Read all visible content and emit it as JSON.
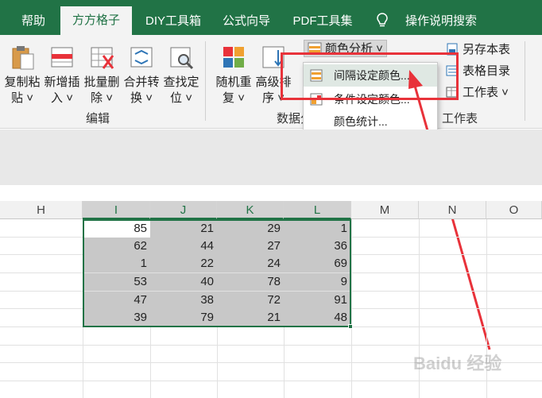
{
  "tabs": [
    {
      "label": "帮助",
      "active": false
    },
    {
      "label": "方方格子",
      "active": true
    },
    {
      "label": "DIY工具箱",
      "active": false
    },
    {
      "label": "公式向导",
      "active": false
    },
    {
      "label": "PDF工具集",
      "active": false
    }
  ],
  "tell_me": "操作说明搜索",
  "ribbon": {
    "edit_buttons": [
      {
        "line1": "复制粘",
        "line2": "贴 ˅"
      },
      {
        "line1": "新增插",
        "line2": "入 ˅"
      },
      {
        "line1": "批量删",
        "line2": "除 ˅"
      },
      {
        "line1": "合并转",
        "line2": "换 ˅"
      },
      {
        "line1": "查找定",
        "line2": "位 ˅"
      }
    ],
    "edit_group_label": "编辑",
    "analysis_buttons": [
      {
        "line1": "随机重",
        "line2": "复 ˅"
      },
      {
        "line1": "高级排",
        "line2": "序 ˅"
      }
    ],
    "analysis_group_label": "数据分",
    "color_analysis": "颜色分析 ˅",
    "worksheet_items": [
      "另存本表",
      "表格目录",
      "工作表 ˅"
    ],
    "worksheet_group_label": "工作表",
    "partial_right": "存"
  },
  "dropdown": {
    "items": [
      "间隔设定颜色...",
      "条件设定颜色...",
      "颜色统计..."
    ]
  },
  "accent_color": "#217346",
  "highlight_color": "#e8323a",
  "grid": {
    "columns": [
      "H",
      "I",
      "J",
      "K",
      "L",
      "M",
      "N",
      "O"
    ],
    "rows": [
      [
        "85",
        "21",
        "29",
        "1"
      ],
      [
        "62",
        "44",
        "27",
        "36"
      ],
      [
        "1",
        "22",
        "24",
        "69"
      ],
      [
        "53",
        "40",
        "78",
        "9"
      ],
      [
        "47",
        "38",
        "72",
        "91"
      ],
      [
        "39",
        "79",
        "21",
        "48"
      ]
    ]
  },
  "watermark": "Baidu 经验"
}
